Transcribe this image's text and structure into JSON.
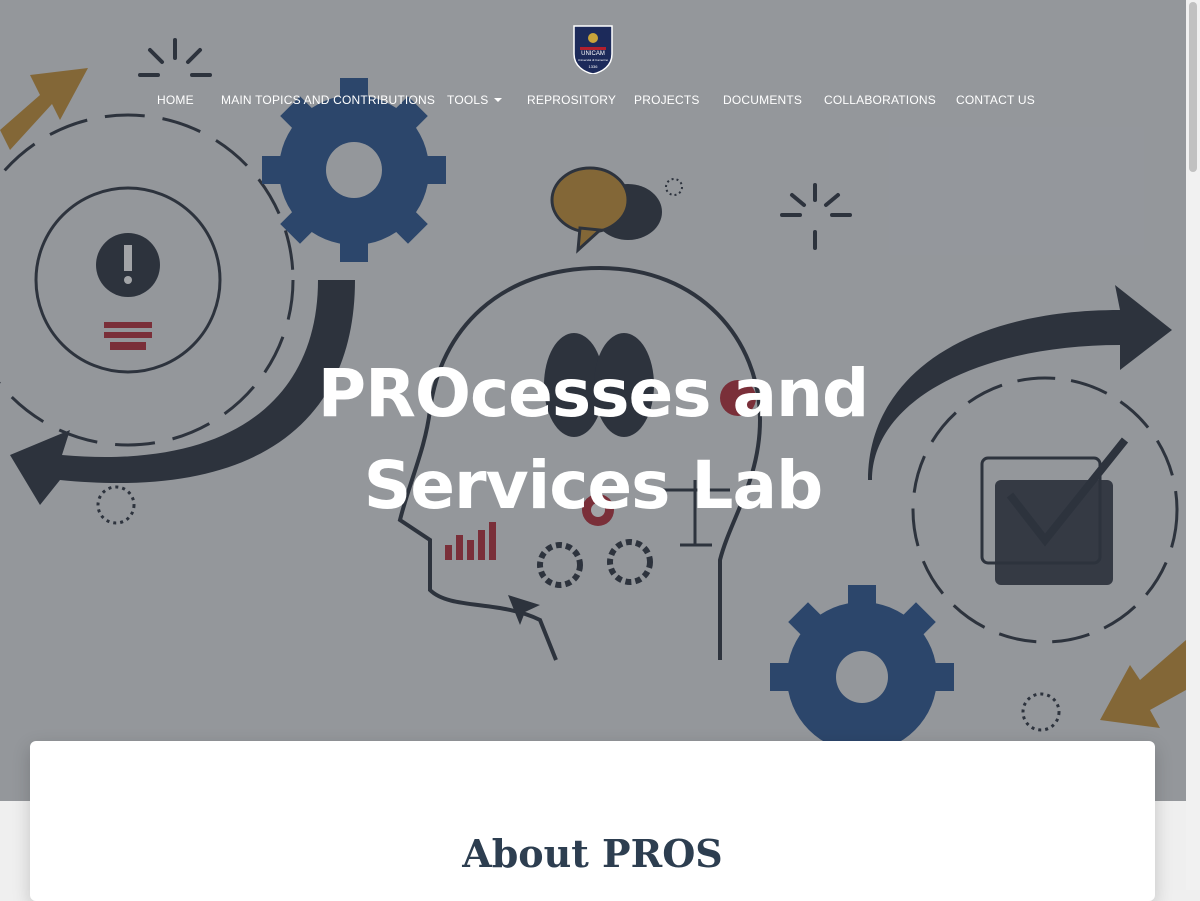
{
  "logo": {
    "text": "UNICAM",
    "subtext": "Università di Camerino",
    "year": "1336"
  },
  "nav": {
    "items": [
      {
        "label": "HOME"
      },
      {
        "label": "MAIN TOPICS AND CONTRIBUTIONS"
      },
      {
        "label": "TOOLS",
        "has_dropdown": true
      },
      {
        "label": "REPROSITORY"
      },
      {
        "label": "PROJECTS"
      },
      {
        "label": "DOCUMENTS"
      },
      {
        "label": "COLLABORATIONS"
      },
      {
        "label": "CONTACT US"
      }
    ]
  },
  "hero": {
    "title_line1": "PROcesses and",
    "title_line2": "Services Lab"
  },
  "about": {
    "title": "About PROS"
  },
  "colors": {
    "overlay": "#3c4048",
    "gear_blue": "#1e4c8c",
    "arrow_orange": "#c48a2a",
    "dark_navy": "#1f2735",
    "accent_red": "#b21f2d",
    "heading": "#2d3e50"
  }
}
